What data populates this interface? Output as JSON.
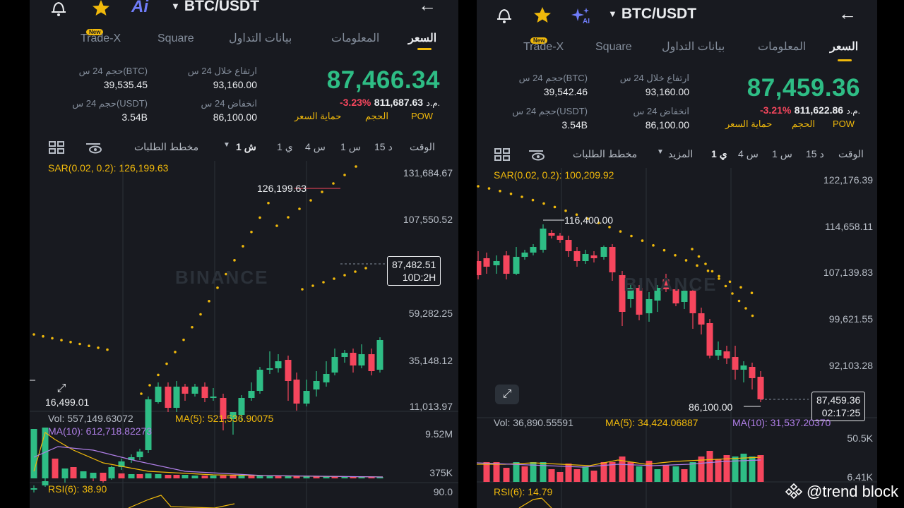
{
  "watermark_brand": "BINANCE",
  "footer": {
    "credit": "@trend block"
  },
  "panels": [
    {
      "id": "left",
      "header": {
        "symbol": "BTC/USDT",
        "ai_label": "Ai"
      },
      "tabs": {
        "price": "السعر",
        "info": "المعلومات",
        "data": "بيانات التداول",
        "square": "Square",
        "tradex": "Trade-X",
        "new_badge": "New"
      },
      "stats": {
        "price": "87,466.34",
        "cny_label": "م.د.",
        "cny_value": "811,687.63",
        "change_pct": "-3.23%",
        "tag_pow": "POW",
        "tag_volume": "الحجم",
        "tag_protect": "حماية السعر",
        "high_label": "ارتفاع خلال 24 س",
        "high_value": "93,160.00",
        "low_label": "انخفاض 24 س",
        "low_value": "86,100.00",
        "vol_btc_label": "حجم 24 س(BTC)",
        "vol_btc_value": "39,535.45",
        "vol_usdt_label": "حجم 24 س(USDT)",
        "vol_usdt_value": "3.54B"
      },
      "timeframes": {
        "time": "الوقت",
        "m15": "15 د",
        "h1": "1 س",
        "h4": "4 س",
        "d1": "1 ي",
        "w1": "1 ش",
        "more": "",
        "depth": "مخطط الطلبات"
      },
      "chart": {
        "sar_label": "SAR(0.02, 0.2): 126,199.63",
        "axis": [
          "131,684.67",
          "107,550.52",
          "59,282.25",
          "35,148.12",
          "11,013.97"
        ],
        "high_marker": "126,199.63",
        "low_marker": "16,499.01",
        "current_price": "87,482.51",
        "countdown": "10D:2H"
      },
      "volume": {
        "vol_label": "Vol: 557,149.63072",
        "ma5_label": "MA(5): 521,536.90075",
        "ma10_label": "MA(10): 612,718.82273",
        "axis_top": "9.52M",
        "axis_bottom": "375K"
      },
      "rsi": {
        "label": "RSI(6): 38.90",
        "axis_top": "90.0"
      }
    },
    {
      "id": "right",
      "header": {
        "symbol": "BTC/USDT",
        "ai_label": "AI"
      },
      "tabs": {
        "price": "السعر",
        "info": "المعلومات",
        "data": "بيانات التداول",
        "square": "Square",
        "tradex": "Trade-X",
        "new_badge": "New"
      },
      "stats": {
        "price": "87,459.36",
        "cny_label": "م.د.",
        "cny_value": "811,622.86",
        "change_pct": "-3.21%",
        "tag_pow": "POW",
        "tag_volume": "الحجم",
        "tag_protect": "حماية السعر",
        "high_label": "ارتفاع خلال 24 س",
        "high_value": "93,160.00",
        "low_label": "انخفاض 24 س",
        "low_value": "86,100.00",
        "vol_btc_label": "حجم 24 س(BTC)",
        "vol_btc_value": "39,542.46",
        "vol_usdt_label": "حجم 24 س(USDT)",
        "vol_usdt_value": "3.54B"
      },
      "timeframes": {
        "time": "الوقت",
        "m15": "15 د",
        "h1": "1 س",
        "h4": "4 س",
        "d1": "1 ي",
        "w1": "",
        "more": "المزيد",
        "depth": "مخطط الطلبات"
      },
      "chart": {
        "sar_label": "SAR(0.02, 0.2): 100,209.92",
        "axis": [
          "122,176.39",
          "114,658.11",
          "107,139.83",
          "99,621.55",
          "92,103.28"
        ],
        "high_marker": "116,400.00",
        "low_marker": "86,100.00",
        "current_price": "87,459.36",
        "countdown": "02:17:25"
      },
      "volume": {
        "vol_label": "Vol: 36,890.55591",
        "ma5_label": "MA(5): 34,424.06887",
        "ma10_label": "MA(10): 31,537.20370",
        "axis_top": "50.5K",
        "axis_bottom": "6.41K"
      },
      "rsi": {
        "label": "RSI(6): 14.79",
        "axis_top": ""
      }
    }
  ],
  "colors": {
    "up": "#2ebd85",
    "down": "#f6465d",
    "sar": "#f0b90b",
    "ma5": "#f0b90b",
    "ma10": "#b07fe8",
    "bg": "#181a20"
  },
  "icons": [
    "bell-icon",
    "star-icon",
    "ai-icon",
    "back-arrow-icon",
    "grid-icon",
    "eye-settings-icon",
    "expand-icon"
  ],
  "chart_data": [
    {
      "type": "candlestick",
      "title": "BTC/USDT weekly",
      "y_axis_ticks": [
        131684.67,
        107550.52,
        59282.25,
        35148.12,
        11013.97
      ],
      "sar_value": 126199.63,
      "annotated_high": 126199.63,
      "annotated_low": 16499.01,
      "last_price": 87482.51
    },
    {
      "type": "candlestick",
      "title": "BTC/USDT daily",
      "y_axis_ticks": [
        122176.39,
        114658.11,
        107139.83,
        99621.55,
        92103.28
      ],
      "sar_value": 100209.92,
      "annotated_high": 116400.0,
      "annotated_low": 86100.0,
      "last_price": 87459.36
    }
  ]
}
